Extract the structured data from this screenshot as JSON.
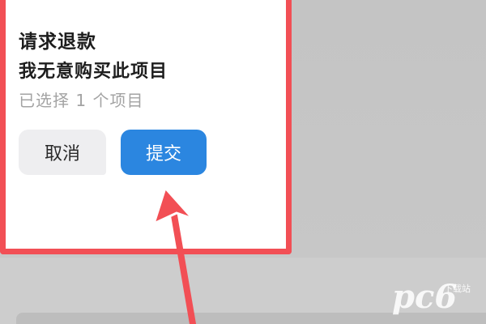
{
  "dialog": {
    "title": "请求退款",
    "reason": "我无意购买此项目",
    "selected_count": "已选择 1 个项目",
    "cancel_label": "取消",
    "submit_label": "提交"
  },
  "watermark": {
    "logo": "pc6",
    "sub": "下载站"
  },
  "colors": {
    "highlight_border": "#f24f55",
    "submit_button": "#2b86e0",
    "cancel_button": "#eeeef0",
    "arrow": "#f24f55"
  },
  "icons": {
    "pointer": "arrow-pointer-icon"
  }
}
